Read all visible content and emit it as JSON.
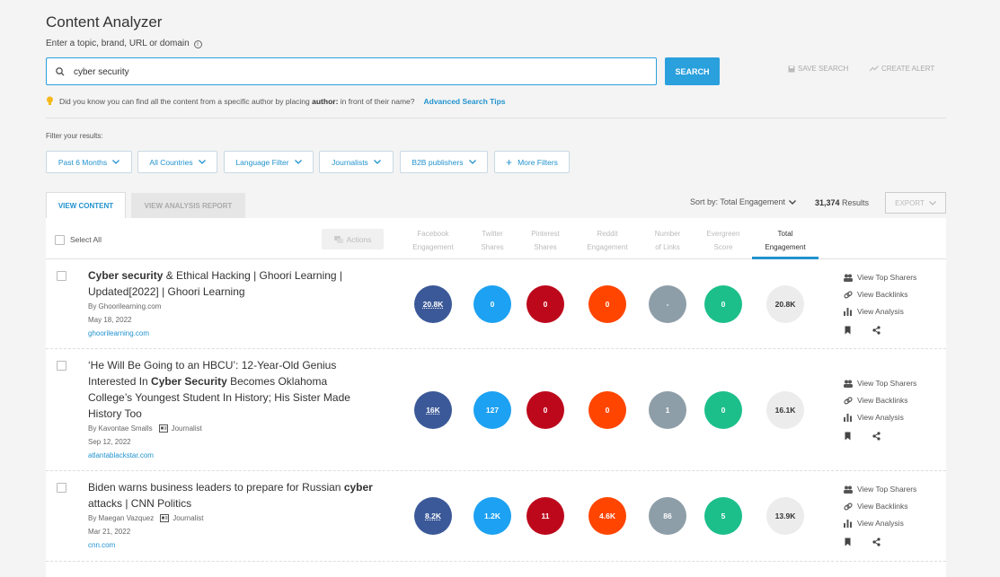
{
  "header": {
    "title": "Content Analyzer",
    "subtitle": "Enter a topic, brand, URL or domain",
    "info_icon": "i"
  },
  "search": {
    "value": "cyber security",
    "button": "SEARCH",
    "save_search": "SAVE SEARCH",
    "create_alert": "CREATE ALERT"
  },
  "tip": {
    "prefix": "Did you know you can find all the content from a specific author by placing",
    "keyword": "author:",
    "suffix": "in front of their name?",
    "link": "Advanced Search Tips"
  },
  "filters": {
    "label": "Filter your results:",
    "items": [
      "Past 6 Months",
      "All Countries",
      "Language Filter",
      "Journalists",
      "B2B publishers"
    ],
    "more": "More Filters"
  },
  "tabs": {
    "view_content": "VIEW CONTENT",
    "view_analysis": "VIEW ANALYSIS REPORT"
  },
  "sort": {
    "label": "Sort by: Total Engagement",
    "results_count": "31,374",
    "results_label": "Results",
    "export": "EXPORT"
  },
  "table": {
    "select_all": "Select All",
    "actions": "Actions",
    "columns": [
      {
        "line1": "Facebook",
        "line2": "Engagement"
      },
      {
        "line1": "Twitter",
        "line2": "Shares"
      },
      {
        "line1": "Pinterest",
        "line2": "Shares"
      },
      {
        "line1": "Reddit",
        "line2": "Engagement"
      },
      {
        "line1": "Number",
        "line2": "of Links"
      },
      {
        "line1": "Evergreen",
        "line2": "Score"
      },
      {
        "line1": "Total",
        "line2": "Engagement"
      }
    ],
    "row_actions": {
      "top_sharers": "View Top Sharers",
      "backlinks": "View Backlinks",
      "analysis": "View Analysis"
    },
    "rows": [
      {
        "title_bold": "Cyber security",
        "title_rest": " & Ethical Hacking | Ghoori Learning | Updated[2022] | Ghoori Learning",
        "author": "By  Ghoorilearning.com",
        "journalist": "",
        "date": "May 18, 2022",
        "domain": "ghoorilearning.com",
        "facebook": "20.8K",
        "twitter": "0",
        "pinterest": "0",
        "reddit": "0",
        "links": "-",
        "evergreen": "0",
        "total": "20.8K"
      },
      {
        "title_pre": "‘He Will Be Going to an HBCU’: 12-Year-Old Genius Interested In ",
        "title_bold": "Cyber Security",
        "title_rest": " Becomes Oklahoma College’s Youngest Student In History; His Sister Made History Too",
        "author": "By  Kavontae Smalls",
        "journalist": "Journalist",
        "date": "Sep 12, 2022",
        "domain": "atlantablackstar.com",
        "facebook": "16K",
        "twitter": "127",
        "pinterest": "0",
        "reddit": "0",
        "links": "1",
        "evergreen": "0",
        "total": "16.1K"
      },
      {
        "title_pre": "Biden warns business leaders to prepare for Russian ",
        "title_bold": "cyber",
        "title_rest": " attacks | CNN Politics",
        "author": "By  Maegan Vazquez",
        "journalist": "Journalist",
        "date": "Mar 21, 2022",
        "domain": "cnn.com",
        "facebook": "8.2K",
        "twitter": "1.2K",
        "pinterest": "11",
        "reddit": "4.6K",
        "links": "86",
        "evergreen": "5",
        "total": "13.9K"
      }
    ]
  }
}
